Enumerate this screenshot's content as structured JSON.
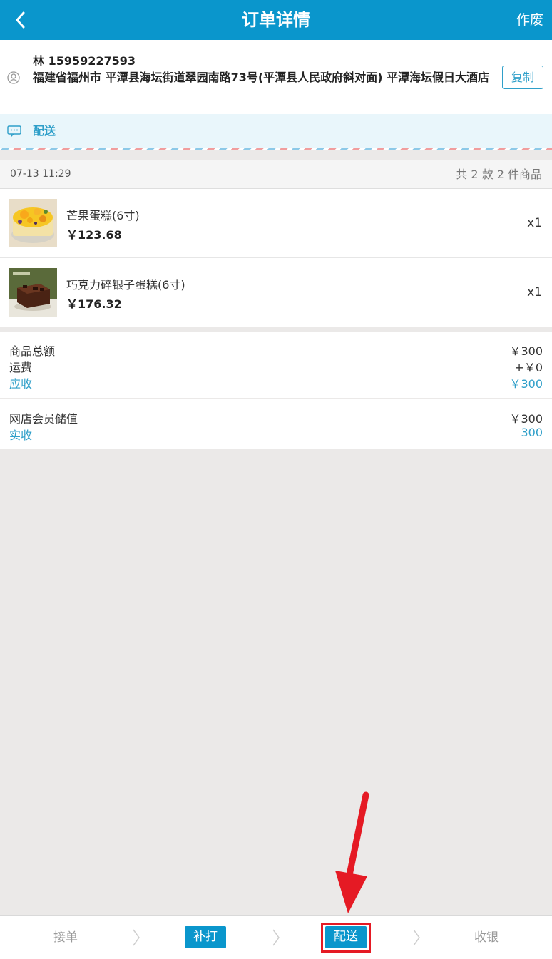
{
  "header": {
    "title": "订单详情",
    "void_label": "作废"
  },
  "address": {
    "name_phone": "林 15959227593",
    "address": "福建省福州市 平潭县海坛街道翠园南路73号(平潭县人民政府斜对面) 平潭海坛假日大酒店",
    "copy_label": "复制"
  },
  "delivery": {
    "label": "配送"
  },
  "order": {
    "time": "07-13 11:29",
    "count_text": "共 2 款 2 件商品"
  },
  "items": [
    {
      "name": "芒果蛋糕(6寸)",
      "price": "￥123.68",
      "qty": "x1"
    },
    {
      "name": "巧克力碎银子蛋糕(6寸)",
      "price": "￥176.32",
      "qty": "x1"
    }
  ],
  "summary": {
    "subtotal_label": "商品总额",
    "subtotal_value": "￥300",
    "shipping_label": "运费",
    "shipping_value": "+￥0",
    "receivable_label": "应收",
    "receivable_value": "￥300"
  },
  "payment": {
    "method_label": "网店会员储值",
    "method_value": "￥300",
    "received_label": "实收",
    "received_value": "300"
  },
  "bottom_steps": [
    "接单",
    "补打",
    "配送",
    "收银"
  ],
  "colors": {
    "brand": "#0a96cc",
    "accent_text": "#2f9fc9",
    "highlight": "#e51a24"
  }
}
